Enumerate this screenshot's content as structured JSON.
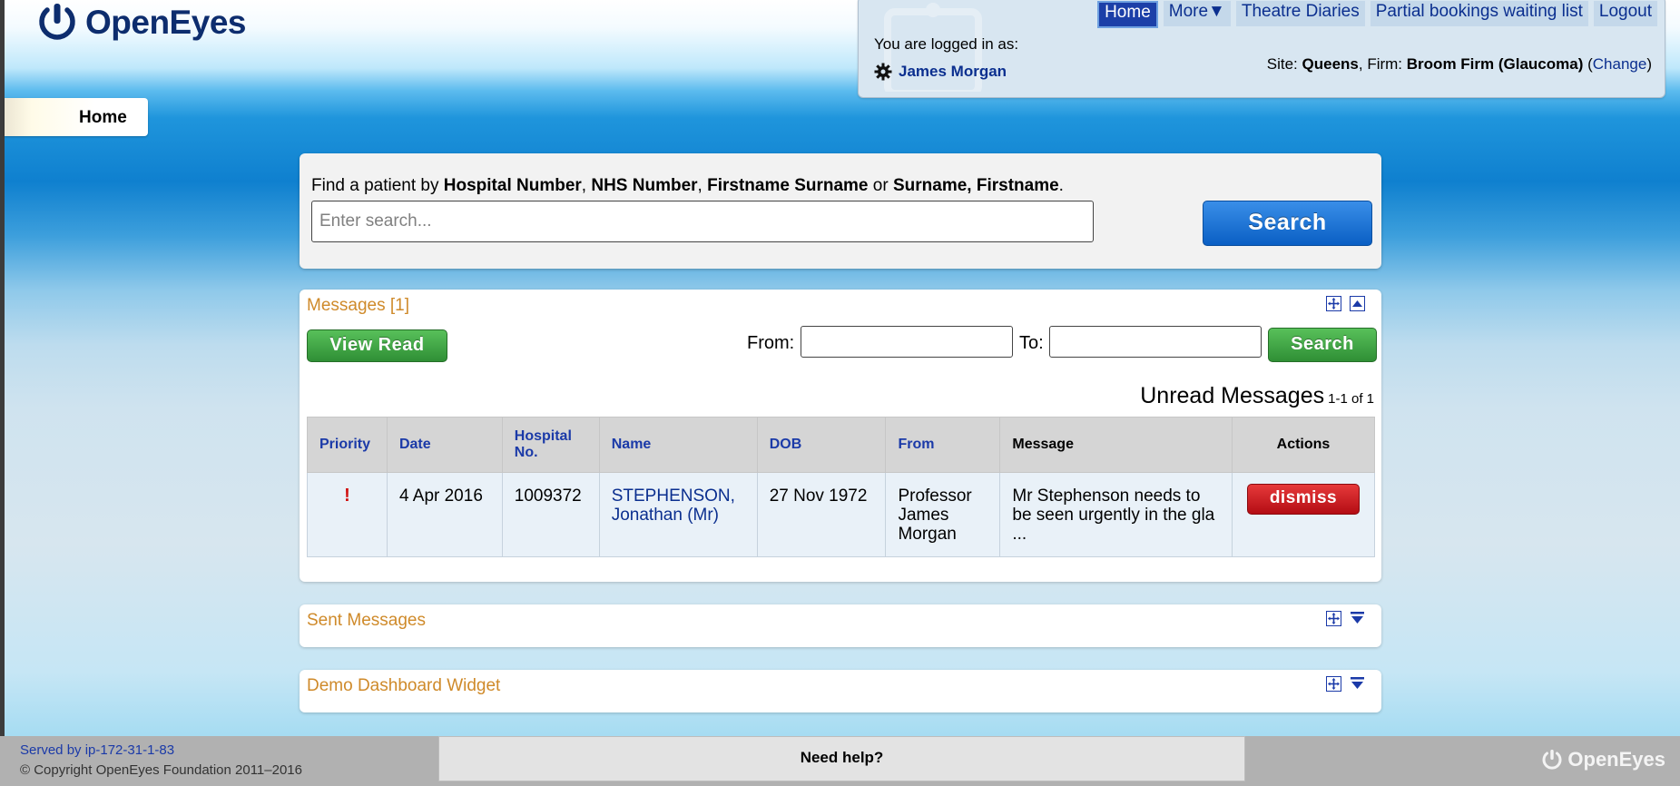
{
  "brand": {
    "name": "OpenEyes"
  },
  "nav": {
    "items": [
      "Home",
      "More▼",
      "Theatre Diaries",
      "Partial bookings waiting list",
      "Logout"
    ]
  },
  "user": {
    "logged_in_label": "You are logged in as:",
    "name": "James Morgan",
    "site_label": "Site:",
    "site": "Queens",
    "firm_label": "Firm:",
    "firm": "Broom Firm (Glaucoma)",
    "change_link": "Change"
  },
  "tab": {
    "home": "Home"
  },
  "search": {
    "hint_prefix": "Find a patient by",
    "hint_hospital": "Hospital Number",
    "hint_comma1": ",",
    "hint_nhs": "NHS Number",
    "hint_comma2": ",",
    "hint_fs": "Firstname Surname",
    "hint_or": "or",
    "hint_sf": "Surname, Firstname",
    "hint_end": ".",
    "placeholder": "Enter search...",
    "button_label": "Search"
  },
  "messages": {
    "title": "Messages [1]",
    "view_read_label": "View Read",
    "from_label": "From:",
    "to_label": "To:",
    "search_label": "Search",
    "unread_title": "Unread Messages",
    "unread_count": "1-1 of 1",
    "columns": [
      "Priority",
      "Date",
      "Hospital No.",
      "Name",
      "DOB",
      "From",
      "Message",
      "Actions"
    ],
    "rows": [
      {
        "priority": "!",
        "date": "4 Apr 2016",
        "hospital_no": "1009372",
        "name": "STEPHENSON, Jonathan (Mr)",
        "dob": "27 Nov 1972",
        "from": "Professor James Morgan",
        "message": "Mr Stephenson needs to be seen urgently in the gla ...",
        "action": "dismiss"
      }
    ]
  },
  "sent_messages": {
    "title": "Sent Messages"
  },
  "demo_widget": {
    "title": "Demo Dashboard Widget"
  },
  "footer": {
    "served_by": "Served by ip-172-31-1-83",
    "copyright": "© Copyright OpenEyes Foundation 2011–2016",
    "help_label": "Need help?",
    "logo_text": "OpenEyes"
  },
  "colors": {
    "brand_navy": "#0d2d6e",
    "link_blue": "#0b2f8f",
    "widget_title": "#cf8a2a",
    "search_button": "#1a6fd6",
    "green_button": "#3ea443",
    "dismiss_button": "#cc1f22",
    "priority_red": "#d01010"
  }
}
